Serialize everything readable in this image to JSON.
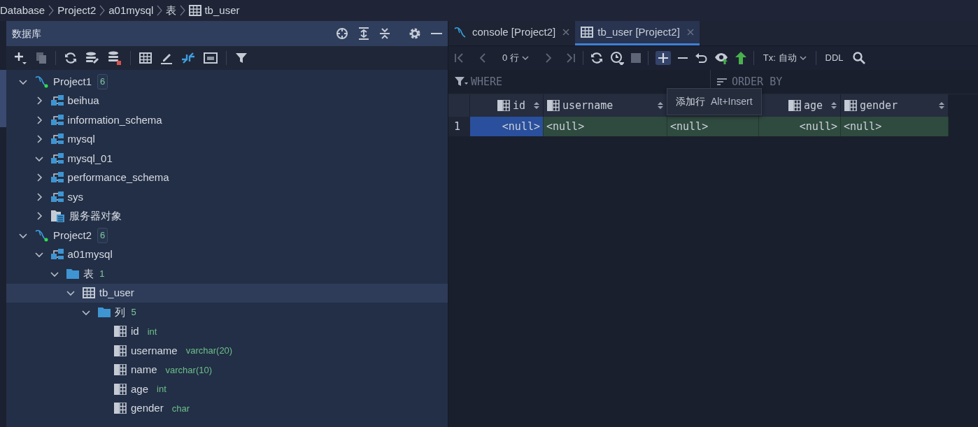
{
  "breadcrumb": [
    {
      "label": "Database",
      "kind": "path"
    },
    {
      "label": "Project2",
      "kind": "path"
    },
    {
      "label": "a01mysql",
      "kind": "path"
    },
    {
      "label": "表",
      "kind": "path"
    },
    {
      "label": "tb_user",
      "kind": "table"
    }
  ],
  "database_panel": {
    "title": "数据库",
    "tree": [
      {
        "label": "Project1",
        "kind": "datasource",
        "count": "6",
        "expanded": true,
        "selected": false,
        "children": [
          {
            "label": "beihua",
            "kind": "schema",
            "expanded": false,
            "selected": false
          },
          {
            "label": "information_schema",
            "kind": "schema",
            "expanded": false,
            "selected": false
          },
          {
            "label": "mysql",
            "kind": "schema",
            "expanded": false,
            "selected": false
          },
          {
            "label": "mysql_01",
            "kind": "schema",
            "expanded": true,
            "selected": false
          },
          {
            "label": "performance_schema",
            "kind": "schema",
            "expanded": false,
            "selected": false
          },
          {
            "label": "sys",
            "kind": "schema",
            "expanded": false,
            "selected": false
          },
          {
            "label": "服务器对象",
            "kind": "server",
            "expanded": false,
            "selected": false
          }
        ]
      },
      {
        "label": "Project2",
        "kind": "datasource",
        "count": "6",
        "expanded": true,
        "selected": false,
        "children": [
          {
            "label": "a01mysql",
            "kind": "schema",
            "expanded": true,
            "selected": false,
            "children": [
              {
                "label": "表",
                "kind": "folder",
                "count": "1",
                "expanded": true,
                "selected": false,
                "children": [
                  {
                    "label": "tb_user",
                    "kind": "table",
                    "expanded": true,
                    "selected": true,
                    "children": [
                      {
                        "label": "列",
                        "kind": "folder",
                        "count": "5",
                        "expanded": true,
                        "selected": false,
                        "children": [
                          {
                            "label": "id",
                            "kind": "column",
                            "type": "int",
                            "selected": false
                          },
                          {
                            "label": "username",
                            "kind": "column",
                            "type": "varchar(20)",
                            "selected": false
                          },
                          {
                            "label": "name",
                            "kind": "column",
                            "type": "varchar(10)",
                            "selected": false
                          },
                          {
                            "label": "age",
                            "kind": "column",
                            "type": "int",
                            "selected": false
                          },
                          {
                            "label": "gender",
                            "kind": "column",
                            "type": "char",
                            "selected": false
                          }
                        ]
                      }
                    ]
                  }
                ]
              }
            ]
          }
        ]
      }
    ]
  },
  "editor_tabs": [
    {
      "label": "console [Project2]",
      "kind": "console",
      "selected": false
    },
    {
      "label": "tb_user [Project2]",
      "kind": "table",
      "selected": true
    }
  ],
  "grid_toolbar": {
    "rows_label": "0 行",
    "tx_label": "Tx: 自动",
    "ddl_label": "DDL"
  },
  "filter": {
    "where": "WHERE",
    "order_by": "ORDER BY"
  },
  "tooltip": {
    "action": "添加行",
    "shortcut": "Alt+Insert"
  },
  "table": {
    "columns": [
      {
        "label": "id",
        "kind": "number"
      },
      {
        "label": "username",
        "kind": "text"
      },
      {
        "kind": "text"
      },
      {
        "label": "age",
        "kind": "number"
      },
      {
        "label": "gender",
        "kind": "text"
      }
    ],
    "rows": [
      {
        "number": "1",
        "cells": [
          {
            "value": "<null>",
            "selected": true
          },
          {
            "value": "<null>",
            "selected": false
          },
          {
            "value": "<null>",
            "selected": false
          },
          {
            "value": "<null>",
            "selected": false
          },
          {
            "value": "<null>",
            "selected": false
          }
        ]
      }
    ]
  }
}
